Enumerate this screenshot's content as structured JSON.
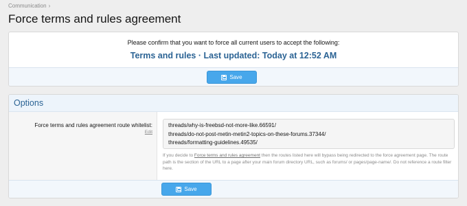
{
  "breadcrumb": {
    "items": [
      "Communication"
    ],
    "separator": "›"
  },
  "page": {
    "title": "Force terms and rules agreement"
  },
  "confirm": {
    "text": "Please confirm that you want to force all current users to accept the following:",
    "link_text": "Terms and rules · Last updated: Today at 12:52 AM",
    "save_label": "Save"
  },
  "options": {
    "title": "Options",
    "field_label": "Force terms and rules agreement route whitelist:",
    "edit_label": "Edit",
    "whitelist_lines": [
      "threads/why-is-freebsd-not-more-like.66591/",
      "threads/do-not-post-metin-metin2-topics-on-these-forums.37344/",
      "threads/formatting-guidelines.49535/"
    ],
    "explain_prefix": "If you decide to ",
    "explain_link": "Force terms and rules agreement",
    "explain_suffix": " then the routes listed here will bypass being redirected to the force agreement page. The route path is the section of the URL to a page after your main forum directory URL, such as forums/ or pages/page-name/. Do not reference a route filter here.",
    "save_label": "Save"
  },
  "icons": {
    "save": "save-icon",
    "breadcrumb_chevron": "chevron-right-icon"
  },
  "colors": {
    "accent": "#47a7eb",
    "link": "#2b6394",
    "footer_bg": "#f2f7fc"
  }
}
